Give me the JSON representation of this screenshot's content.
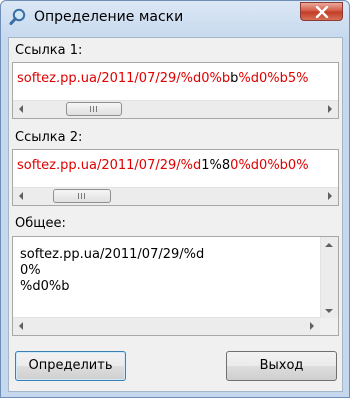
{
  "window": {
    "title": "Определение маски",
    "icon": "search-icon",
    "close_icon": "close-icon"
  },
  "link1": {
    "label": "Ссылка 1:",
    "value_red_1": "softez.pp.ua/2011/07/29/%d0%b",
    "value_black": "b",
    "value_red_2": "%d0%b5%"
  },
  "link2": {
    "label": "Ссылка 2:",
    "value_red_1": "softez.pp.ua/2011/07/29/%d",
    "value_black": "1%8",
    "value_red_2": "0%d0%b0%"
  },
  "common": {
    "label": "Общее:",
    "lines": [
      "softez.pp.ua/2011/07/29/%d",
      "0%",
      "%d0%b"
    ]
  },
  "buttons": {
    "detect": "Определить",
    "exit": "Выход"
  },
  "colors": {
    "highlight": "#e00000",
    "default_button_border": "#3c7fb1",
    "close_button": "#c23a22"
  }
}
